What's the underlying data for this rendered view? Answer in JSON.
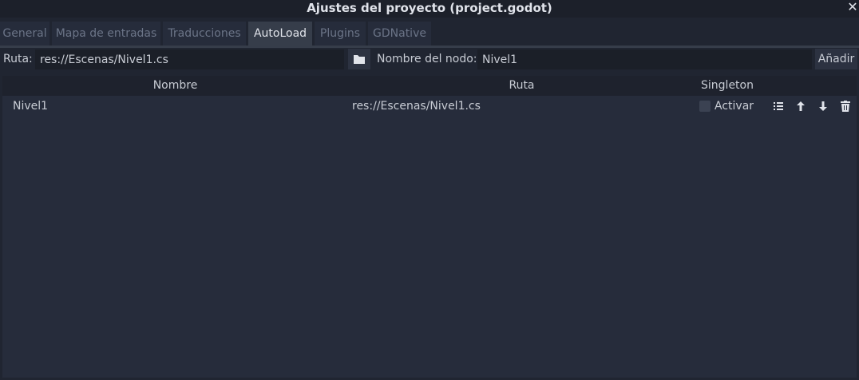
{
  "window": {
    "title": "Ajustes del proyecto (project.godot)",
    "close_glyph": "✕"
  },
  "tabs": [
    {
      "label": "General",
      "active": false
    },
    {
      "label": "Mapa de entradas",
      "active": false
    },
    {
      "label": "Traducciones",
      "active": false
    },
    {
      "label": "AutoLoad",
      "active": true
    },
    {
      "label": "Plugins",
      "active": false
    },
    {
      "label": "GDNative",
      "active": false
    }
  ],
  "autoload_form": {
    "path_label": "Ruta:",
    "path_value": "res://Escenas/Nivel1.cs",
    "browse_icon": "folder-icon",
    "node_name_label": "Nombre del nodo:",
    "node_name_value": "Nivel1",
    "add_label": "Añadir"
  },
  "table": {
    "columns": [
      "Nombre",
      "Ruta",
      "Singleton"
    ],
    "rows": [
      {
        "name": "Nivel1",
        "path": "res://Escenas/Nivel1.cs",
        "singleton_label": "Activar",
        "singleton_enabled": false,
        "actions": [
          "list-icon",
          "move-up-icon",
          "move-down-icon",
          "trash-icon"
        ]
      }
    ]
  },
  "colors": {
    "background": "#202531",
    "panel": "#262c3b",
    "active_tab": "#363d4a",
    "field": "#1b1f28",
    "text": "#c8ccd4"
  }
}
